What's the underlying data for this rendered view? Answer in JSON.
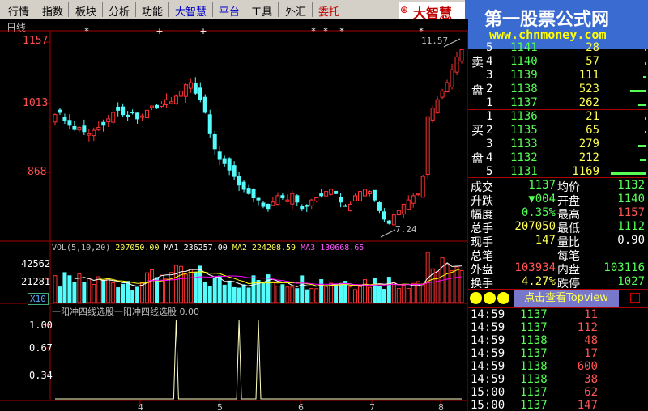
{
  "menu": {
    "items": [
      "行情",
      "指数",
      "板块",
      "分析",
      "功能",
      "大智慧",
      "平台",
      "工具",
      "外汇",
      "委托"
    ],
    "brand": "大智慧"
  },
  "watermark": {
    "title": "第一股票公式网",
    "url": "www.chnmoney.com"
  },
  "chart": {
    "period": "日线",
    "price_axis": [
      "1157",
      "1013",
      "868"
    ],
    "high_anno": "11.57",
    "low_anno": "7.24",
    "vol_axis": [
      "42562",
      "21281"
    ],
    "vol_multiplier": "X10",
    "vol_legend": {
      "name": "VOL(5,10,20)",
      "vol": "207050.00",
      "ma1": "MA1 236257.00",
      "ma2": "MA2 224208.59",
      "ma3": "MA3 130668.65"
    },
    "indicator_legend": "一阳冲四线选股一阳冲四线选股 0.00",
    "indicator_axis": [
      "1.00",
      "0.67",
      "0.34"
    ],
    "x_ticks": [
      "4",
      "5",
      "6",
      "7",
      "8"
    ],
    "colors": {
      "up": "#ff3232",
      "down": "#54fcfc",
      "ma1": "#ffffff",
      "ma2": "#ffff00",
      "ma3": "#ff00ff"
    }
  },
  "chart_data": {
    "type": "candlestick",
    "price_range": [
      7.0,
      11.7
    ],
    "highest": 11.57,
    "lowest": 7.24,
    "closes": [
      9.85,
      9.9,
      9.7,
      9.6,
      9.5,
      9.55,
      9.45,
      9.4,
      9.48,
      9.55,
      9.6,
      9.75,
      9.9,
      9.95,
      9.85,
      9.8,
      9.9,
      9.75,
      9.82,
      9.95,
      10.05,
      10.0,
      10.1,
      10.2,
      10.15,
      10.28,
      10.4,
      10.55,
      10.6,
      10.35,
      10.2,
      9.9,
      9.4,
      9.05,
      8.8,
      8.7,
      8.55,
      8.4,
      8.2,
      8.1,
      8.0,
      7.9,
      7.85,
      7.7,
      7.65,
      7.8,
      7.95,
      7.9,
      7.85,
      8.0,
      7.8,
      7.65,
      7.7,
      7.85,
      7.9,
      7.95,
      8.05,
      8.1,
      8.0,
      7.8,
      7.7,
      7.75,
      7.95,
      8.05,
      8.1,
      8.05,
      7.85,
      7.6,
      7.4,
      7.3,
      7.5,
      7.6,
      7.75,
      7.85,
      7.95,
      8.0,
      8.4,
      9.8,
      10.0,
      10.2,
      10.4,
      10.6,
      10.9,
      11.2,
      11.37
    ],
    "indicator_signals": [
      25,
      38,
      42
    ]
  },
  "sell_book": {
    "label_top": "卖",
    "label_bottom": "盘",
    "rows": [
      {
        "level": "5",
        "price": "1141",
        "vol": "28"
      },
      {
        "level": "4",
        "price": "1140",
        "vol": "57"
      },
      {
        "level": "3",
        "price": "1139",
        "vol": "111"
      },
      {
        "level": "2",
        "price": "1138",
        "vol": "523"
      },
      {
        "level": "1",
        "price": "1137",
        "vol": "262"
      }
    ]
  },
  "buy_book": {
    "label_top": "买",
    "label_bottom": "盘",
    "rows": [
      {
        "level": "1",
        "price": "1136",
        "vol": "21"
      },
      {
        "level": "2",
        "price": "1135",
        "vol": "65"
      },
      {
        "level": "3",
        "price": "1133",
        "vol": "279"
      },
      {
        "level": "4",
        "price": "1132",
        "vol": "212"
      },
      {
        "level": "5",
        "price": "1131",
        "vol": "1169"
      }
    ]
  },
  "quote": {
    "rows": [
      {
        "l1": "成交",
        "v1": "1137",
        "l2": "均价",
        "v2": "1132",
        "c1": "#5f5",
        "c2": "#5f5"
      },
      {
        "l1": "升跌",
        "v1": "▼004",
        "l2": "开盘",
        "v2": "1140",
        "c1": "#5f5",
        "c2": "#5f5"
      },
      {
        "l1": "幅度",
        "v1": "0.35%",
        "l2": "最高",
        "v2": "1157",
        "c1": "#5f5",
        "c2": "#f55"
      },
      {
        "l1": "总手",
        "v1": "207050",
        "l2": "最低",
        "v2": "1112",
        "c1": "#ff5",
        "c2": "#5f5"
      },
      {
        "l1": "现手",
        "v1": "147",
        "l2": "量比",
        "v2": "0.90",
        "c1": "#ff5",
        "c2": "#fff"
      },
      {
        "l1": "总笔",
        "v1": "",
        "l2": "每笔",
        "v2": "",
        "c1": "#ff5",
        "c2": "#fff"
      },
      {
        "l1": "外盘",
        "v1": "103934",
        "l2": "内盘",
        "v2": "103116",
        "c1": "#f55",
        "c2": "#5f5"
      },
      {
        "l1": "换手",
        "v1": "4.27%",
        "l2": "跌停",
        "v2": "1027",
        "c1": "#ff5",
        "c2": "#5f5"
      }
    ]
  },
  "topview_button": "点击查看Topview",
  "ticks": [
    {
      "time": "14:59",
      "price": "1137",
      "vol": "11"
    },
    {
      "time": "14:59",
      "price": "1137",
      "vol": "112"
    },
    {
      "time": "14:59",
      "price": "1138",
      "vol": "48"
    },
    {
      "time": "14:59",
      "price": "1137",
      "vol": "17"
    },
    {
      "time": "14:59",
      "price": "1138",
      "vol": "600"
    },
    {
      "time": "14:59",
      "price": "1138",
      "vol": "38"
    },
    {
      "time": "15:00",
      "price": "1137",
      "vol": "62"
    },
    {
      "time": "15:00",
      "price": "1137",
      "vol": "147"
    }
  ]
}
